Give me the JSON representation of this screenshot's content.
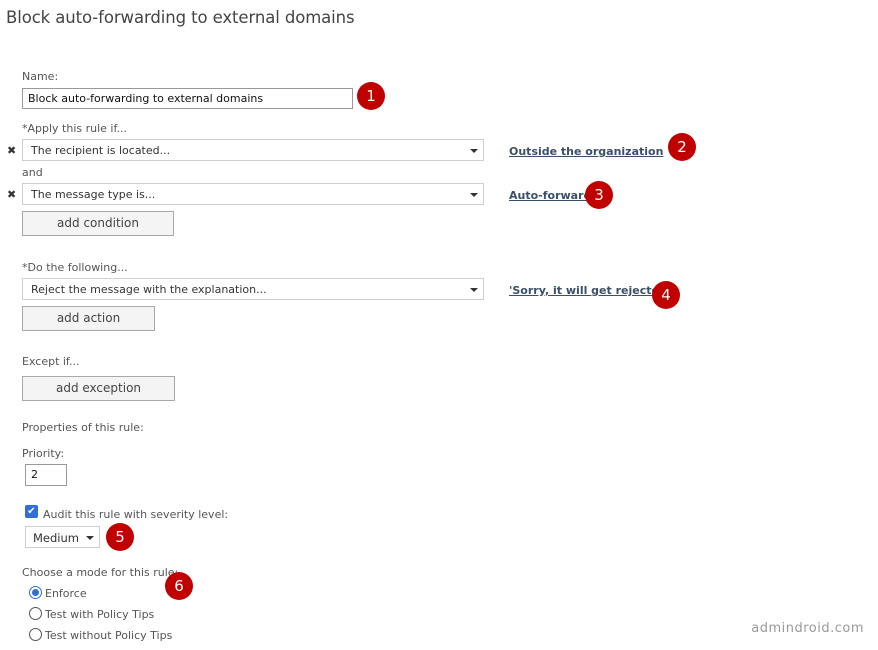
{
  "page": {
    "title": "Block auto-forwarding to external domains"
  },
  "name_field": {
    "label": "Name:",
    "value": "Block auto-forwarding to external domains"
  },
  "conditions": {
    "label": "*Apply this rule if...",
    "connector": "and",
    "items": [
      {
        "remove_icon": "✖",
        "selected": "The recipient is located...",
        "value_link": "Outside the organization"
      },
      {
        "remove_icon": "✖",
        "selected": "The message type is...",
        "value_link": "Auto-forward"
      }
    ],
    "add_label": "add condition"
  },
  "actions": {
    "label": "*Do the following...",
    "items": [
      {
        "selected": "Reject the message with the explanation...",
        "value_link": "'Sorry, it will get rejected'"
      }
    ],
    "add_label": "add action"
  },
  "exceptions": {
    "label": "Except if...",
    "add_label": "add exception"
  },
  "properties": {
    "label": "Properties of this rule:",
    "priority_label": "Priority:",
    "priority_value": "2",
    "audit_label": "Audit this rule with severity level:",
    "audit_checked": true,
    "audit_check_glyph": "✔",
    "severity_selected": "Medium"
  },
  "mode": {
    "label": "Choose a mode for this rule:",
    "options": [
      {
        "label": "Enforce",
        "checked": true
      },
      {
        "label": "Test with Policy Tips",
        "checked": false
      },
      {
        "label": "Test without Policy Tips",
        "checked": false
      }
    ]
  },
  "annotations": {
    "badge_color": "#c00000",
    "numbers": [
      "1",
      "2",
      "3",
      "4",
      "5",
      "6"
    ]
  },
  "watermark": "admindroid.com"
}
